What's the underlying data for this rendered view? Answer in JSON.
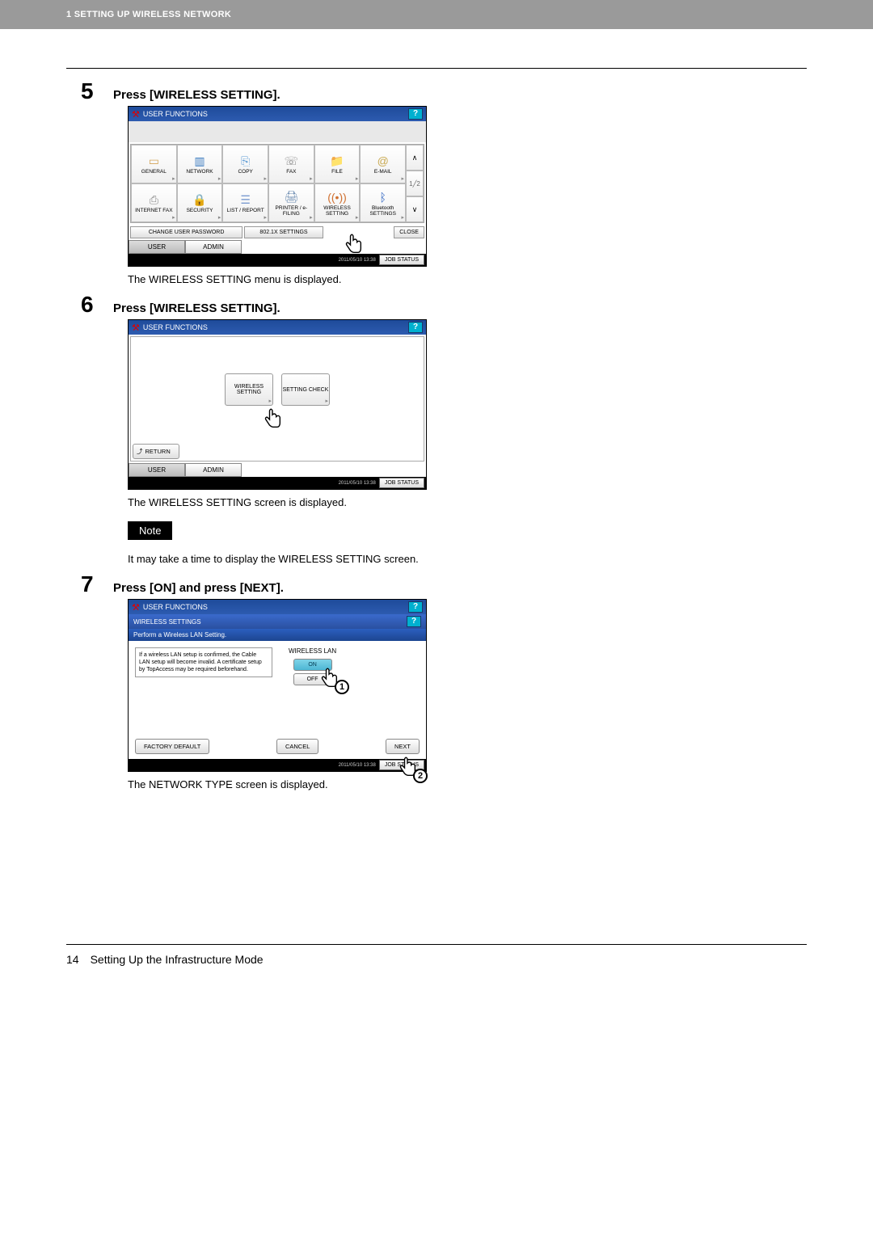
{
  "header": {
    "chapter": "1 SETTING UP WIRELESS NETWORK"
  },
  "steps": [
    {
      "num": "5",
      "title": "Press [WIRELESS SETTING].",
      "after_text": "The WIRELESS SETTING menu is displayed.",
      "screen": {
        "title": "USER FUNCTIONS",
        "grid_row1": [
          {
            "label": "GENERAL"
          },
          {
            "label": "NETWORK"
          },
          {
            "label": "COPY"
          },
          {
            "label": "FAX"
          },
          {
            "label": "FILE"
          },
          {
            "label": "E-MAIL"
          }
        ],
        "grid_row2": [
          {
            "label": "INTERNET FAX"
          },
          {
            "label": "SECURITY"
          },
          {
            "label": "LIST / REPORT"
          },
          {
            "label": "PRINTER / e-FILING"
          },
          {
            "label": "WIRELESS SETTING"
          },
          {
            "label": "Bluetooth SETTINGS"
          }
        ],
        "page_top": "1",
        "page_bot": "2",
        "btn_change_pwd": "CHANGE USER PASSWORD",
        "btn_8021x": "802.1X SETTINGS",
        "btn_close": "CLOSE",
        "tab_user": "USER",
        "tab_admin": "ADMIN",
        "timestamp": "2011/05/10 13:38",
        "job_status": "JOB STATUS"
      }
    },
    {
      "num": "6",
      "title": "Press [WIRELESS SETTING].",
      "after_text": "The WIRELESS SETTING screen is displayed.",
      "note_label": "Note",
      "note_text": "It may take a time to display the WIRELESS SETTING screen.",
      "screen": {
        "title": "USER FUNCTIONS",
        "btn_wireless": "WIRELESS SETTING",
        "btn_check": "SETTING CHECK",
        "btn_return": "RETURN",
        "tab_user": "USER",
        "tab_admin": "ADMIN",
        "timestamp": "2011/05/10 13:38",
        "job_status": "JOB STATUS"
      }
    },
    {
      "num": "7",
      "title": "Press [ON] and press [NEXT].",
      "after_text": "The NETWORK TYPE screen is displayed.",
      "screen": {
        "title": "USER FUNCTIONS",
        "subtitle": "WIRELESS SETTINGS",
        "instruction": "Perform a Wireless LAN Setting.",
        "info": "If a wireless LAN setup is confirmed, the Cable LAN setup will become invalid. A certificate setup by TopAccess may be required beforehand.",
        "lan_label": "WIRELESS LAN",
        "on": "ON",
        "off": "OFF",
        "btn_factory": "FACTORY DEFAULT",
        "btn_cancel": "CANCEL",
        "btn_next": "NEXT",
        "timestamp": "2011/05/10 13:38",
        "job_status": "JOB STATUS"
      }
    }
  ],
  "footer": {
    "page": "14",
    "title": "Setting Up the Infrastructure Mode"
  }
}
